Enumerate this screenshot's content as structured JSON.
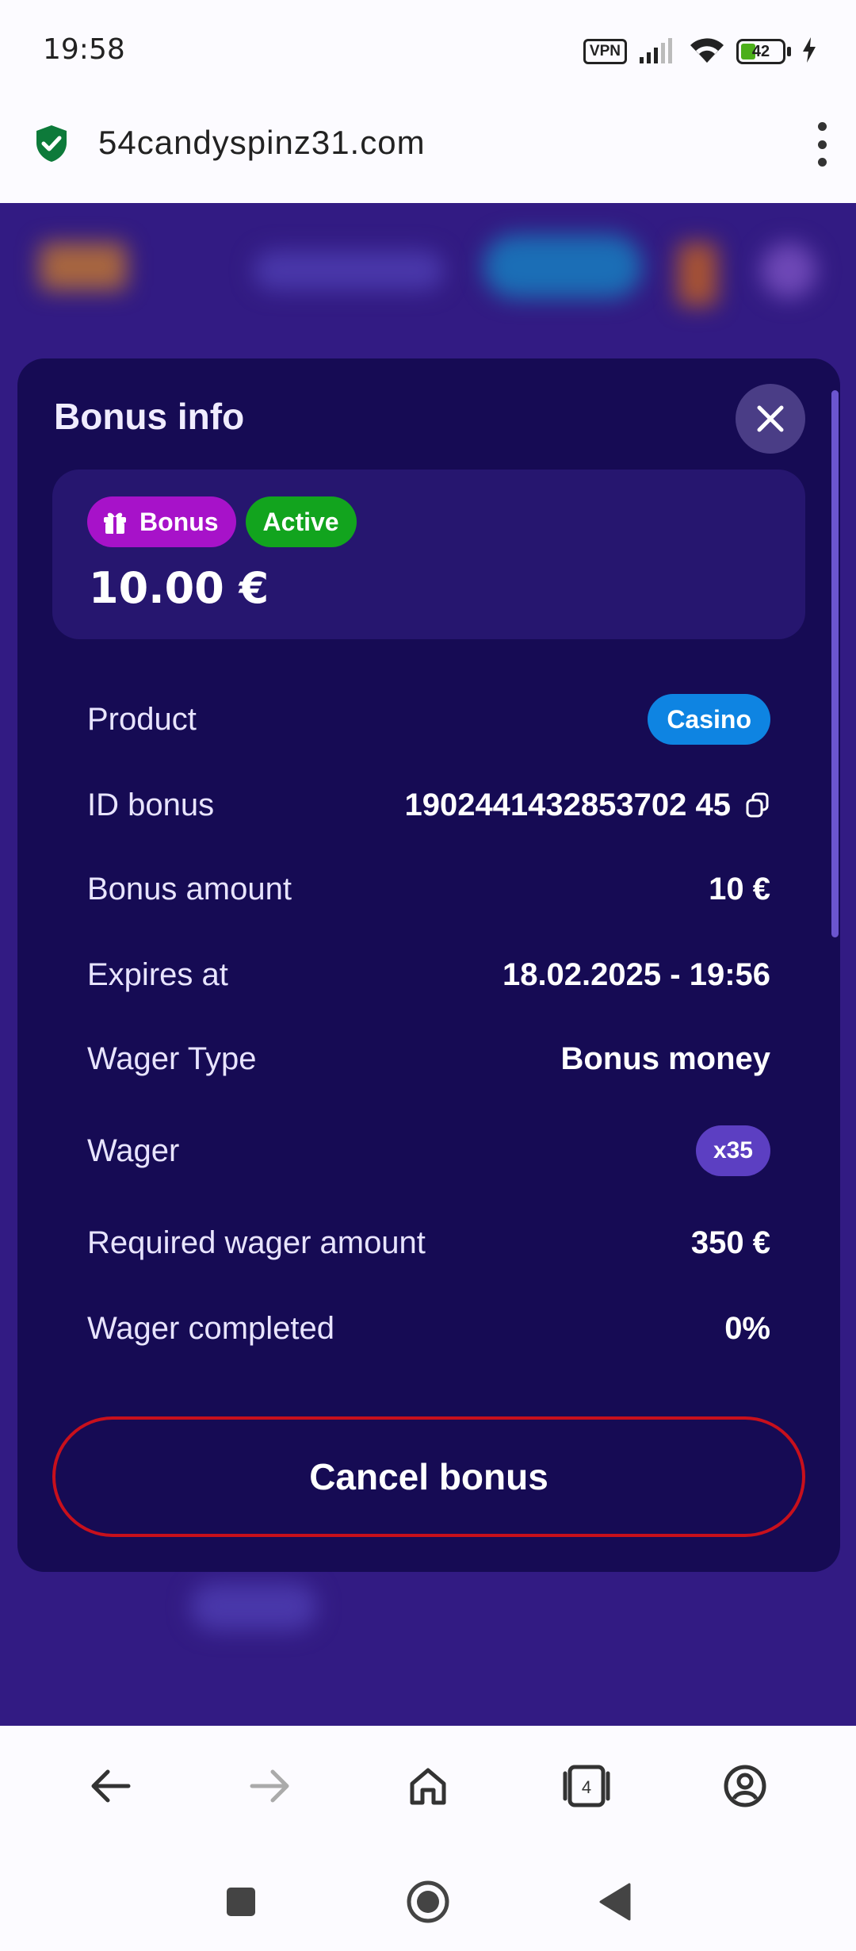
{
  "status_bar": {
    "time": "19:58",
    "vpn": "VPN",
    "battery": "42"
  },
  "browser": {
    "url": "54candyspinz31.com",
    "tab_count": "4"
  },
  "modal": {
    "title": "Bonus info",
    "card": {
      "type_badge": "Bonus",
      "status_badge": "Active",
      "amount": "10.00 €"
    },
    "rows": [
      {
        "label": "Product",
        "value": "Casino"
      },
      {
        "label": "ID bonus",
        "value": "1902441432853702 45"
      },
      {
        "label": "Bonus amount",
        "value": "10 €"
      },
      {
        "label": "Expires at",
        "value": "18.02.2025 - 19:56"
      },
      {
        "label": "Wager Type",
        "value": "Bonus money"
      },
      {
        "label": "Wager",
        "value": "x35"
      },
      {
        "label": "Required wager amount",
        "value": "350 €"
      },
      {
        "label": "Wager completed",
        "value": "0%"
      }
    ],
    "cancel_label": "Cancel bonus"
  },
  "colors": {
    "modal_bg": "#160b54",
    "card_bg": "#26166f",
    "bonus_badge": "#a712c9",
    "active_badge": "#12a41e",
    "casino_chip": "#0e84e2",
    "wager_chip": "#5c3fc2",
    "cancel_border": "#c8101c"
  }
}
